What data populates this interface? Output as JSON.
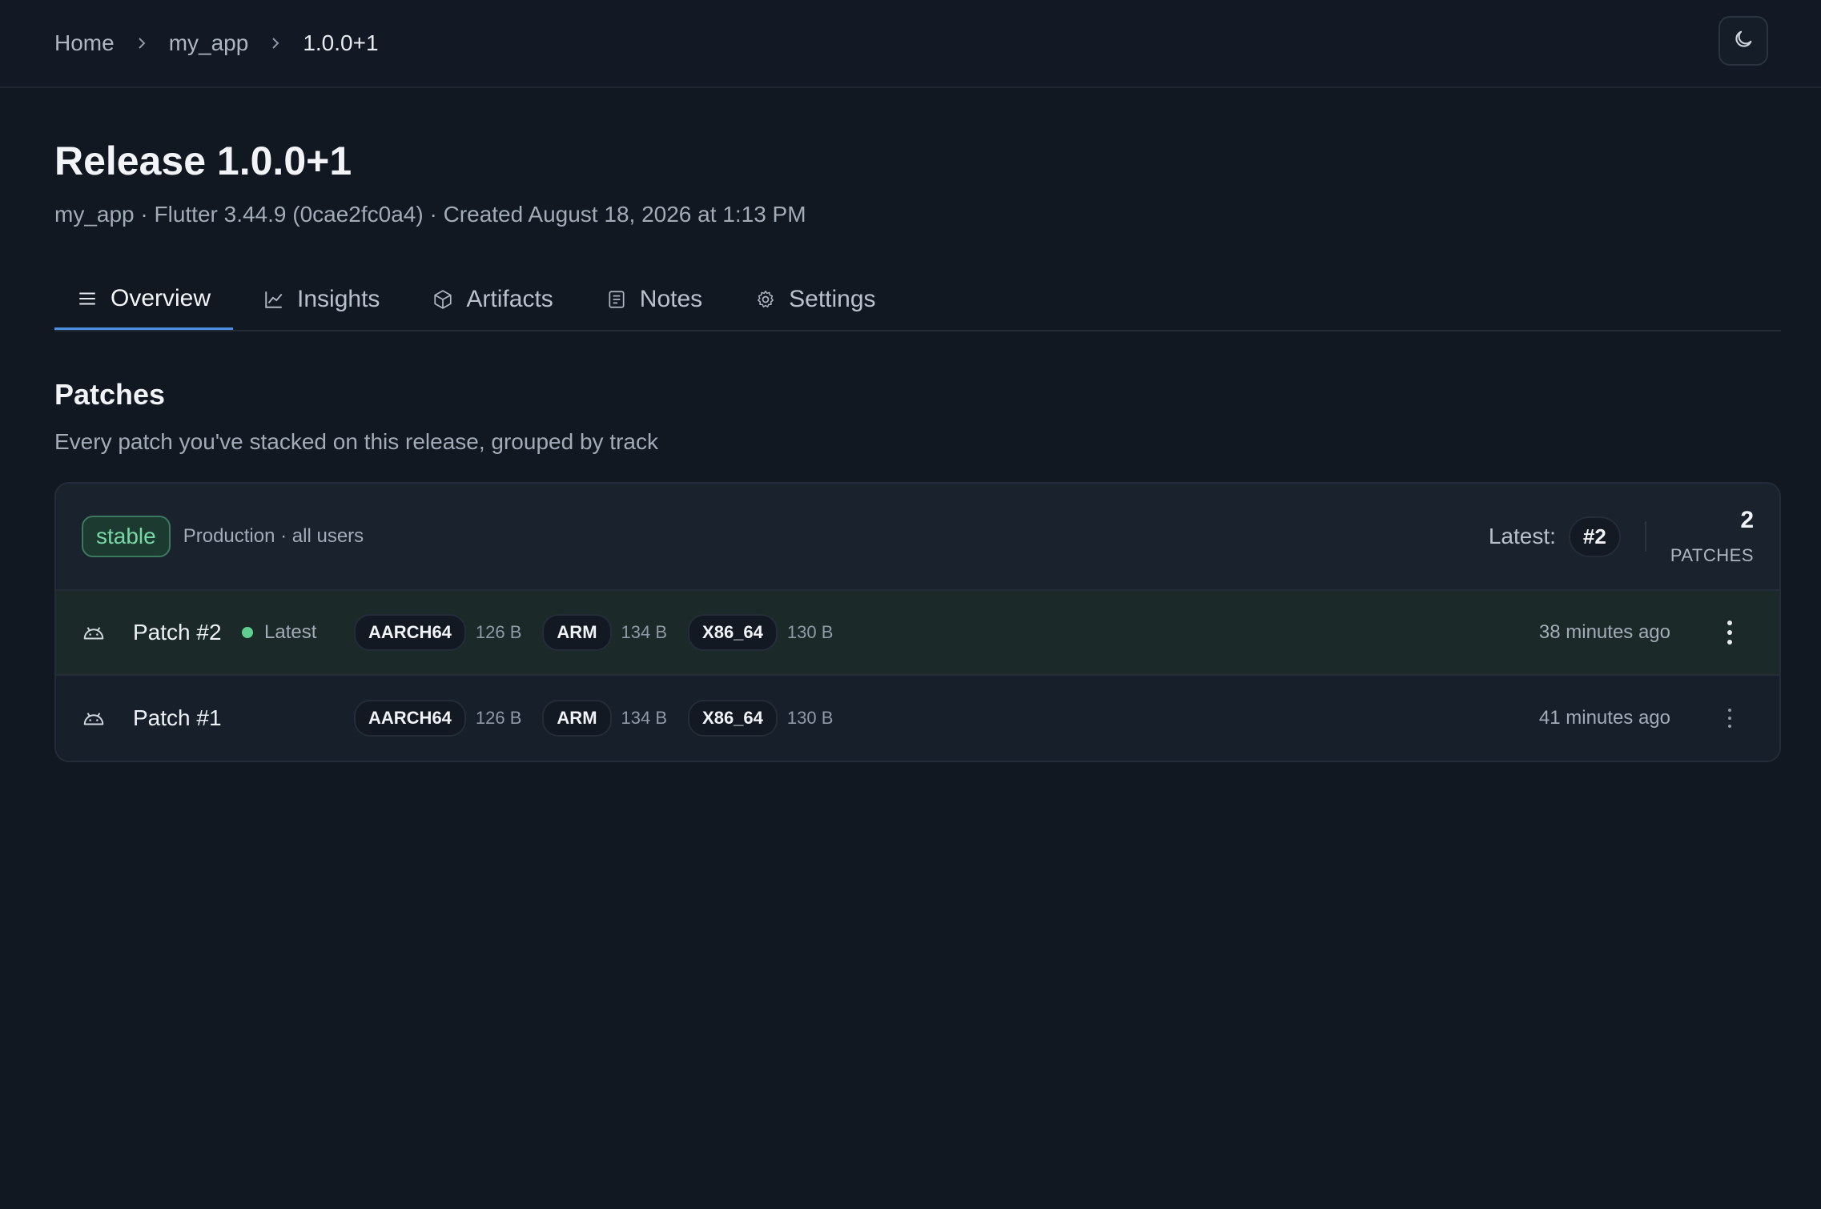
{
  "breadcrumb": [
    "Home",
    "my_app",
    "1.0.0+1"
  ],
  "header": {
    "title": "Release 1.0.0+1",
    "meta": "my_app · Flutter 3.44.9 (0cae2fc0a4) · Created August 18, 2026 at 1:13 PM"
  },
  "tabs": [
    {
      "label": "Overview",
      "icon": "menu-icon",
      "active": true
    },
    {
      "label": "Insights",
      "icon": "chart-icon"
    },
    {
      "label": "Artifacts",
      "icon": "box-icon"
    },
    {
      "label": "Notes",
      "icon": "notes-icon"
    },
    {
      "label": "Settings",
      "icon": "gear-icon"
    }
  ],
  "patches": {
    "title": "Patches",
    "subtitle": "Every patch you've stacked on this release, grouped by track",
    "track": {
      "name": "stable",
      "description": "Production · all users",
      "latest_label": "Latest:",
      "latest_value": "#2",
      "count": "2",
      "count_label": "PATCHES"
    },
    "rows": [
      {
        "name": "Patch #2",
        "latest_tag": "Latest",
        "archs": [
          {
            "arch": "AARCH64",
            "size": "126 B"
          },
          {
            "arch": "ARM",
            "size": "134 B"
          },
          {
            "arch": "X86_64",
            "size": "130 B"
          }
        ],
        "time": "38 minutes ago"
      },
      {
        "name": "Patch #1",
        "archs": [
          {
            "arch": "AARCH64",
            "size": "126 B"
          },
          {
            "arch": "ARM",
            "size": "134 B"
          },
          {
            "arch": "X86_64",
            "size": "130 B"
          }
        ],
        "time": "41 minutes ago"
      }
    ]
  },
  "colors": {
    "accent": "#4d8fe0",
    "stable": "#77d8a6",
    "latest_dot": "#5fcf8f"
  }
}
